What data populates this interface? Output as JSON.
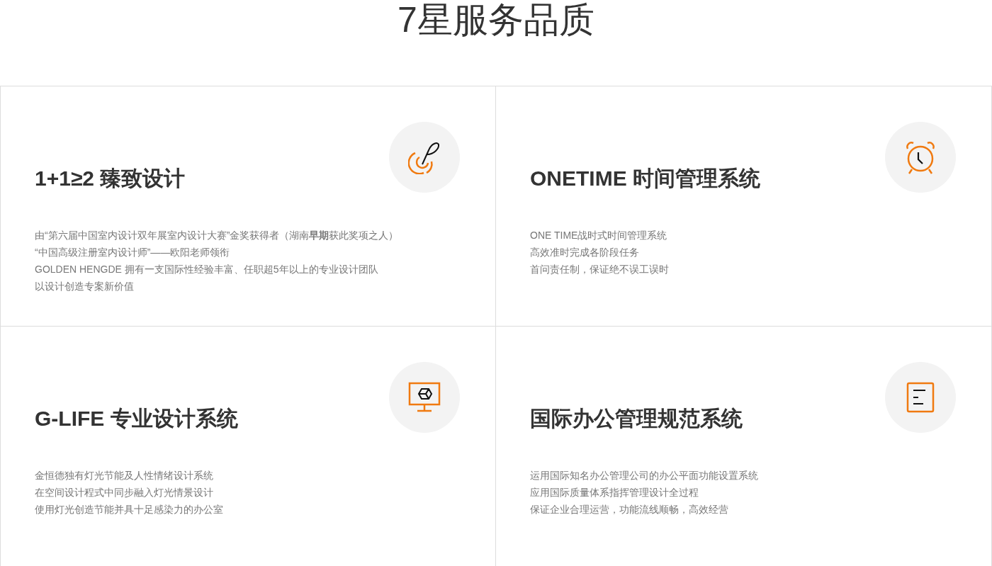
{
  "title": "7星服务品质",
  "cards": [
    {
      "kind": "quill",
      "heading": "1+1≥2 臻致设计",
      "lines": [
        "由“第六届中国室内设计双年展室内设计大赛”金奖获得者（湖南**早期**获此奖项之人）",
        "“中国高级注册室内设计师”——欧阳老师领衔",
        "GOLDEN HENGDE  拥有一支国际性经验丰富、任职超5年以上的专业设计团队",
        "以设计创造专案新价值"
      ]
    },
    {
      "kind": "clock",
      "heading": "ONETIME 时间管理系统",
      "lines": [
        "ONE TIME战时式时间管理系统",
        "高效准时完成各阶段任务",
        "首问责任制，保证绝不误工误时"
      ]
    },
    {
      "kind": "monitor",
      "heading": "G-LIFE 专业设计系统",
      "lines": [
        "金恒德独有灯光节能及人性情绪设计系统",
        "在空间设计程式中同步融入灯光情景设计",
        "使用灯光创造节能并具十足感染力的办公室"
      ]
    },
    {
      "kind": "document",
      "heading": "国际办公管理规范系统",
      "lines": [
        "运用国际知名办公管理公司的办公平面功能设置系统",
        "应用国际质量体系指挥管理设计全过程",
        "保证企业合理运营，功能流线顺畅，高效经营"
      ]
    }
  ]
}
